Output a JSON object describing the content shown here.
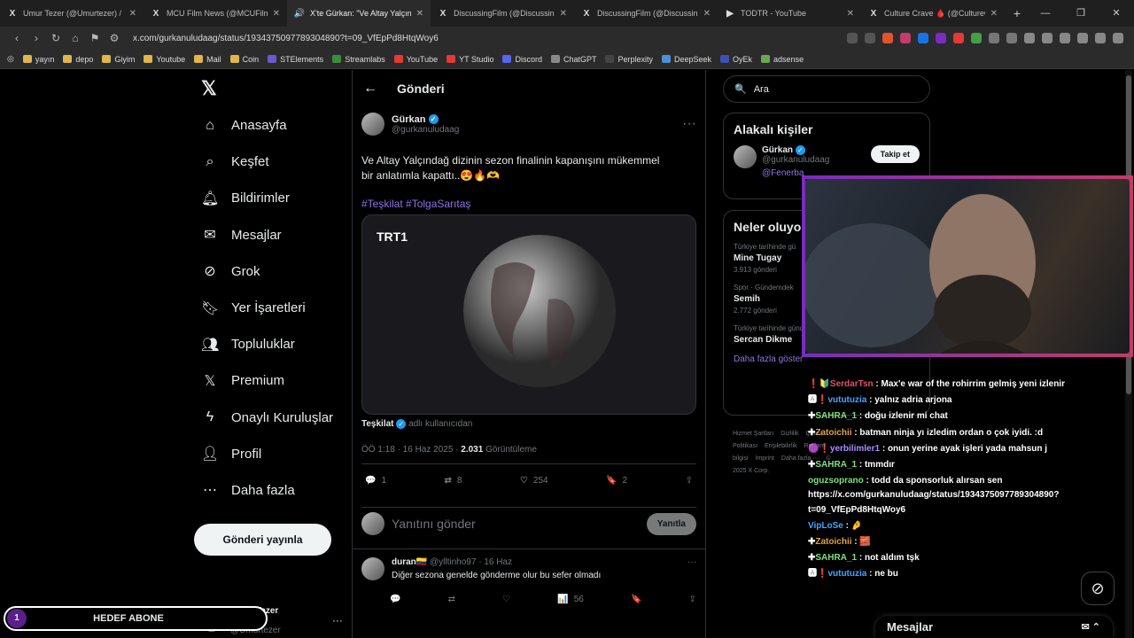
{
  "browser": {
    "tabs": [
      {
        "icon": "X",
        "title": "Umur Tezer (@Umurtezer) / X"
      },
      {
        "icon": "X",
        "title": "MCU Film News (@MCUFilmNews) /"
      },
      {
        "icon": "🔊",
        "title": "X'te Gürkan: \"Ve Altay Yalçın..."
      },
      {
        "icon": "X",
        "title": "DiscussingFilm (@DiscussingFilm) / X"
      },
      {
        "icon": "X",
        "title": "DiscussingFilm (@DiscussingFilm) / X"
      },
      {
        "icon": "▶",
        "title": "TODTR - YouTube"
      },
      {
        "icon": "X",
        "title": "Culture Crave 🩸 (@CultureCrave) /"
      }
    ],
    "url": "x.com/gurkanuludaag/status/1934375097789304890?t=09_VfEpPd8HtqWoy6",
    "bookmarks": [
      "yayın",
      "depo",
      "Giyim",
      "Youtube",
      "Mail",
      "Coin",
      "STElements",
      "Streamlabs",
      "YouTube",
      "YT Studio",
      "Discord",
      "ChatGPT",
      "Perplexity",
      "DeepSeek",
      "OyEk",
      "adsense"
    ]
  },
  "nav": {
    "items": [
      "Anasayfa",
      "Keşfet",
      "Bildirimler",
      "Mesajlar",
      "Grok",
      "Yer İşaretleri",
      "Topluluklar",
      "Premium",
      "Onaylı Kuruluşlar",
      "Profil",
      "Daha fazla"
    ],
    "post_button": "Gönderi yayınla",
    "profile_name": "Umur Tezer 🔒",
    "profile_handle": "@Umurtezer"
  },
  "main": {
    "header": "Gönderi",
    "author_name": "Gürkan",
    "author_handle": "@gurkanuludaag",
    "text": "Ve Altay Yalçındağ dizinin sezon finalinin kapanışını mükemmel bir anlatımla kapattı..😍🔥🫶",
    "hashtags": "#Teşkilat  #TolgaSarıtaş",
    "media_logo": "TRT1",
    "source_name": "Teşkilat",
    "source_suffix": "adlı kullanıcıdan",
    "meta_time": "ÖÖ 1:18 · 16 Haz 2025 · ",
    "meta_views": "2.031",
    "meta_views_label": " Görüntüleme",
    "stats": {
      "replies": "1",
      "reposts": "8",
      "likes": "254",
      "bookmarks": "2"
    },
    "reply_placeholder": "Yanıtını gönder",
    "reply_button": "Yanıtla",
    "reply": {
      "name": "duran🇨🇴",
      "handle": "@ylltinho97 · 16 Haz",
      "text": "Diğer sezona genelde gönderme olur bu sefer olmadı",
      "views": "56"
    }
  },
  "right": {
    "search_placeholder": "Ara",
    "relevant_title": "Alakalı kişiler",
    "relevant_name": "Gürkan",
    "relevant_handle": "@gurkanuludaag",
    "relevant_bio": "@Fenerba",
    "follow_button": "Takip et",
    "trends_title": "Neler oluyo",
    "trends": [
      {
        "context": "Türkiye tarihinde gü",
        "name": "Mine Tugay",
        "count": "3.913 gönderi"
      },
      {
        "context": "Spor · Gündemdek",
        "name": "Semih",
        "count": "2.772 gönderi"
      },
      {
        "context": "Türkiye tarihinde gündemde",
        "name": "Sercan Dikme",
        "count": ""
      }
    ],
    "show_more": "Daha fazla göster",
    "footer": [
      "Hizmet Şartları",
      "Gizlilik",
      "Çerez Politikası",
      "Erişilebilirlik",
      "Reklam bilgisi",
      "İmprint",
      "Daha fazla ···",
      "© 2025 X Corp."
    ]
  },
  "stream": {
    "chat": [
      {
        "badge": "❗🔰",
        "name": "SerdarTsn",
        "color": "#e0506c",
        "text": "Max'e war of the rohirrim gelmiş yeni izlenir"
      },
      {
        "badge": "🅰❗",
        "name": "vututuzia",
        "color": "#4aa3ff",
        "text": "yalnız adria arjona"
      },
      {
        "badge": "✚",
        "name": "SAHRA_1",
        "color": "#7fe07f",
        "text": "doğu izlenir mi chat"
      },
      {
        "badge": "✚",
        "name": "Zatoichii",
        "color": "#e0a040",
        "text": "batman ninja yı izledim ordan o çok iyidi. :d"
      },
      {
        "badge": "🟣❗",
        "name": "yerbilimler1",
        "color": "#a98cff",
        "text": "onun yerine ayak işleri yada mahsun j"
      },
      {
        "badge": "✚",
        "name": "SAHRA_1",
        "color": "#7fe07f",
        "text": "tmmdır"
      },
      {
        "badge": "",
        "name": "oguzsoprano",
        "color": "#7fe07f",
        "text": "todd da sponsorluk alırsan sen https://x.com/gurkanuludaag/status/1934375097789304890?t=09_VfEpPd8HtqWoy6"
      },
      {
        "badge": "",
        "name": "VipLoSe",
        "color": "#4aa3ff",
        "text": "🤌"
      },
      {
        "badge": "✚",
        "name": "Zatoichii",
        "color": "#e0a040",
        "text": "🧱"
      },
      {
        "badge": "✚",
        "name": "SAHRA_1",
        "color": "#7fe07f",
        "text": "not aldım tşk"
      },
      {
        "badge": "🅰❗",
        "name": "vututuzia",
        "color": "#4aa3ff",
        "text": "ne bu"
      }
    ],
    "goal_number": "1",
    "goal_label": "HEDEF ABONE",
    "messages_label": "Mesajlar"
  }
}
